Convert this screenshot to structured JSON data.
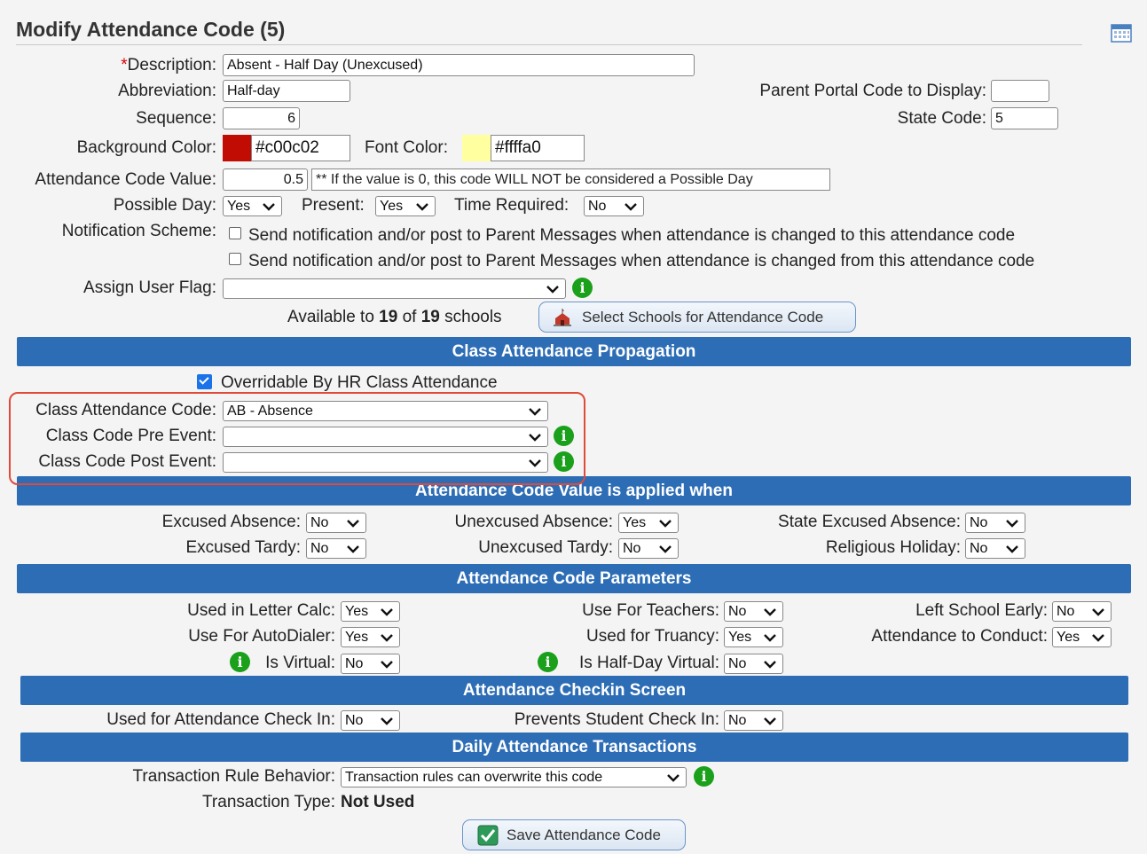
{
  "page": {
    "title": "Modify Attendance Code (5)"
  },
  "general": {
    "description_label": "Description:",
    "description_required_mark": "*",
    "description_value": "Absent - Half Day (Unexcused)",
    "abbreviation_label": "Abbreviation:",
    "abbreviation_value": "Half-day",
    "parent_portal_label": "Parent Portal Code to Display:",
    "parent_portal_value": "",
    "sequence_label": "Sequence:",
    "sequence_value": "6",
    "state_code_label": "State Code:",
    "state_code_value": "5",
    "bg_color_label": "Background Color:",
    "bg_color_value": "#c00c02",
    "font_color_label": "Font Color:",
    "font_color_value": "#ffffa0",
    "code_value_label": "Attendance Code Value:",
    "code_value": "0.5",
    "code_value_note": "** If the value is 0, this code WILL NOT be considered a Possible Day",
    "possible_day_label": "Possible Day:",
    "possible_day_value": "Yes",
    "present_label": "Present:",
    "present_value": "Yes",
    "time_required_label": "Time Required:",
    "time_required_value": "No",
    "notification_label": "Notification Scheme:",
    "notification_to": "Send notification and/or post to Parent Messages when attendance is changed to this attendance code",
    "notification_from": "Send notification and/or post to Parent Messages when attendance is changed from this attendance code",
    "assign_user_flag_label": "Assign User Flag:",
    "assign_user_flag_value": "",
    "available_prefix": "Available to ",
    "available_count": "19",
    "available_of": " of ",
    "available_total": "19",
    "available_suffix": " schools",
    "select_schools_button": "Select Schools for Attendance Code"
  },
  "propagation": {
    "header": "Class Attendance Propagation",
    "overridable_label": "Overridable By HR Class Attendance",
    "overridable_checked": true,
    "class_code_label": "Class Attendance Code:",
    "class_code_value": "AB - Absence",
    "pre_event_label": "Class Code Pre Event:",
    "pre_event_value": "",
    "post_event_label": "Class Code Post Event:",
    "post_event_value": ""
  },
  "applied": {
    "header": "Attendance Code Value is applied when",
    "excused_absence_label": "Excused Absence:",
    "excused_absence_value": "No",
    "unexcused_absence_label": "Unexcused Absence:",
    "unexcused_absence_value": "Yes",
    "state_excused_label": "State Excused Absence:",
    "state_excused_value": "No",
    "excused_tardy_label": "Excused Tardy:",
    "excused_tardy_value": "No",
    "unexcused_tardy_label": "Unexcused Tardy:",
    "unexcused_tardy_value": "No",
    "religious_label": "Religious Holiday:",
    "religious_value": "No"
  },
  "parameters": {
    "header": "Attendance Code Parameters",
    "letter_calc_label": "Used in Letter Calc:",
    "letter_calc_value": "Yes",
    "teachers_label": "Use For Teachers:",
    "teachers_value": "No",
    "left_early_label": "Left School Early:",
    "left_early_value": "No",
    "autodialer_label": "Use For AutoDialer:",
    "autodialer_value": "Yes",
    "truancy_label": "Used for Truancy:",
    "truancy_value": "Yes",
    "conduct_label": "Attendance to Conduct:",
    "conduct_value": "Yes",
    "virtual_label": "Is Virtual:",
    "virtual_value": "No",
    "half_virtual_label": "Is Half-Day Virtual:",
    "half_virtual_value": "No"
  },
  "checkin": {
    "header": "Attendance Checkin Screen",
    "used_label": "Used for Attendance Check In:",
    "used_value": "No",
    "prevents_label": "Prevents Student Check In:",
    "prevents_value": "No"
  },
  "transactions": {
    "header": "Daily Attendance Transactions",
    "rule_label": "Transaction Rule Behavior:",
    "rule_value": "Transaction rules can overwrite this code",
    "type_label": "Transaction Type:",
    "type_value": "Not Used"
  },
  "actions": {
    "save_button": "Save Attendance Code"
  },
  "colors": {
    "section_blue": "#2d6db5",
    "bg_swatch": "#c00c02",
    "font_swatch": "#ffffa0",
    "info_green": "#1aa01a",
    "highlight_red": "#e04a3a"
  },
  "icons": {
    "info": "i"
  }
}
